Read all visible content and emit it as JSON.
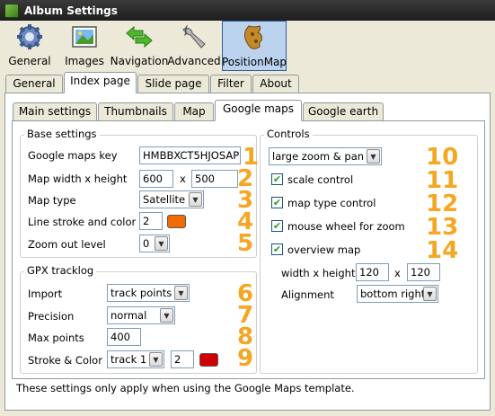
{
  "window": {
    "title": "Album Settings"
  },
  "toolbar": {
    "items": [
      {
        "label": "General",
        "icon": "gear-icon"
      },
      {
        "label": "Images",
        "icon": "picture-icon"
      },
      {
        "label": "Navigation",
        "icon": "arrows-icon"
      },
      {
        "label": "Advanced",
        "icon": "wrench-icon"
      },
      {
        "label": "PositionMap",
        "icon": "map-icon",
        "active": true
      }
    ]
  },
  "main_tabs": [
    "General",
    "Index page",
    "Slide page",
    "Filter",
    "About"
  ],
  "main_tab_selected": "Index page",
  "sub_tabs": [
    "Main settings",
    "Thumbnails",
    "Map",
    "Google maps",
    "Google earth"
  ],
  "sub_tab_selected": "Google maps",
  "base": {
    "title": "Base settings",
    "key_label": "Google maps key",
    "key_value": "HMBBXCT5HJOSAP",
    "size_label": "Map width x height",
    "width": "600",
    "x_sep": "x",
    "height": "500",
    "type_label": "Map type",
    "type_value": "Satellite",
    "stroke_label": "Line stroke and color",
    "stroke_value": "2",
    "stroke_color": "#f26b00",
    "zoom_label": "Zoom out level",
    "zoom_value": "0"
  },
  "gpx": {
    "title": "GPX tracklog",
    "import_label": "Import",
    "import_value": "track points",
    "precision_label": "Precision",
    "precision_value": "normal",
    "maxpoints_label": "Max points",
    "maxpoints_value": "400",
    "stroke_label": "Stroke & Color",
    "track_value": "track 1",
    "stroke_value": "2",
    "stroke_color": "#d10000"
  },
  "controls": {
    "title": "Controls",
    "zoom_value": "large zoom & pan",
    "scale_label": "scale control",
    "maptype_label": "map type control",
    "wheel_label": "mouse wheel for zoom",
    "overview_label": "overview map",
    "checks": [
      true,
      true,
      true,
      true
    ],
    "wh_label": "width x height",
    "ov_width": "120",
    "x_sep": "x",
    "ov_height": "120",
    "align_label": "Alignment",
    "align_value": "bottom right"
  },
  "callouts": [
    "1",
    "2",
    "3",
    "4",
    "5",
    "6",
    "7",
    "8",
    "9",
    "10",
    "11",
    "12",
    "13",
    "14"
  ],
  "footer": {
    "note": "These settings only apply when using the Google Maps template."
  },
  "colors": {
    "callout": "#f5a623",
    "selection": "#bcd3f0"
  }
}
